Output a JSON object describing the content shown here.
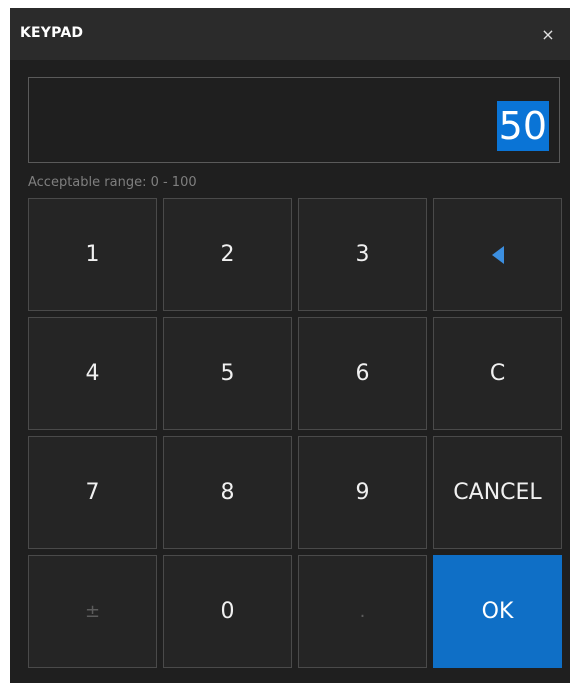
{
  "window": {
    "title": "KEYPAD",
    "close_icon": "×"
  },
  "display": {
    "value": "50",
    "hint": "Acceptable range: 0 - 100"
  },
  "keys": {
    "k1": "1",
    "k2": "2",
    "k3": "3",
    "backspace_icon": "left-triangle-icon",
    "k4": "4",
    "k5": "5",
    "k6": "6",
    "clear": "C",
    "k7": "7",
    "k8": "8",
    "k9": "9",
    "cancel": "CANCEL",
    "plusminus": "±",
    "k0": "0",
    "decimal": ".",
    "ok": "OK"
  },
  "colors": {
    "accent": "#0f6fc6",
    "selection": "#0a74d6",
    "background": "#1f1f1f"
  }
}
